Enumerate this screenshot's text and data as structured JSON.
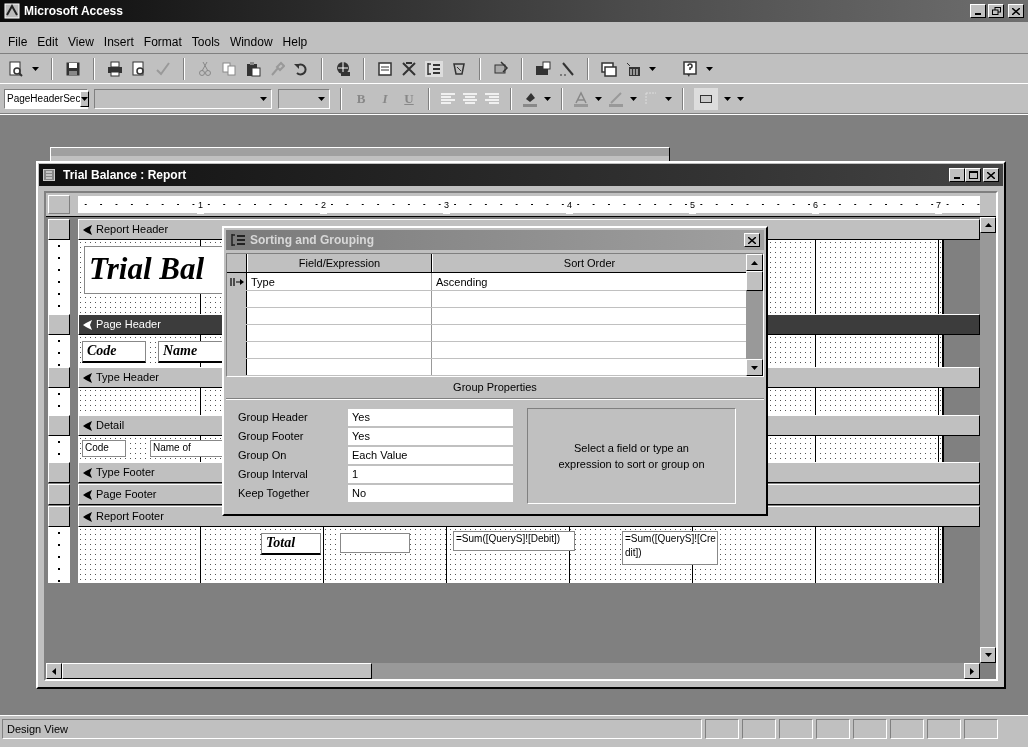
{
  "app_title": "Microsoft Access",
  "menu": [
    {
      "label": "File"
    },
    {
      "label": "Edit"
    },
    {
      "label": "View"
    },
    {
      "label": "Insert"
    },
    {
      "label": "Format"
    },
    {
      "label": "Tools"
    },
    {
      "label": "Window"
    },
    {
      "label": "Help"
    }
  ],
  "format_toolbar": {
    "object_box": "PageHeaderSec",
    "style_buttons": [
      "B",
      "I",
      "U"
    ]
  },
  "report_window": {
    "title": "Trial Balance : Report",
    "ruler": [
      "1",
      "2",
      "3",
      "4",
      "5",
      "6",
      "7"
    ],
    "sections": [
      {
        "label": "Report Header",
        "selected": false,
        "controls": [
          {
            "kind": "title",
            "text": "Trial Bal"
          }
        ]
      },
      {
        "label": "Page Header",
        "selected": true,
        "controls": [
          {
            "kind": "label",
            "text": "Code"
          },
          {
            "kind": "label",
            "text": "Name"
          }
        ]
      },
      {
        "label": "Type Header",
        "selected": false
      },
      {
        "label": "Detail",
        "selected": false,
        "controls": [
          {
            "kind": "textbox",
            "text": "Code"
          },
          {
            "kind": "textbox",
            "text": "Name of"
          }
        ]
      },
      {
        "label": "Type Footer",
        "selected": false
      },
      {
        "label": "Page Footer",
        "selected": false
      },
      {
        "label": "Report Footer",
        "selected": false,
        "controls": [
          {
            "kind": "label",
            "text": "Total"
          },
          {
            "kind": "textbox"
          },
          {
            "kind": "textbox",
            "text": "=Sum([QueryS]![Debit])"
          },
          {
            "kind": "textbox",
            "text": "=Sum([QueryS]![Credit])"
          }
        ]
      }
    ]
  },
  "dialog": {
    "title": "Sorting and Grouping",
    "columns": [
      "Field/Expression",
      "Sort Order"
    ],
    "rows": [
      {
        "field": "Type",
        "sort_order": "Ascending",
        "selected": true
      }
    ],
    "properties_title": "Group Properties",
    "properties": [
      {
        "label": "Group Header",
        "value": "Yes"
      },
      {
        "label": "Group Footer",
        "value": "Yes"
      },
      {
        "label": "Group On",
        "value": "Each Value"
      },
      {
        "label": "Group Interval",
        "value": "1"
      },
      {
        "label": "Keep Together",
        "value": "No"
      }
    ],
    "hint": "Select a field or type an expression to sort or group on"
  },
  "status_bar": {
    "text": "Design View"
  }
}
